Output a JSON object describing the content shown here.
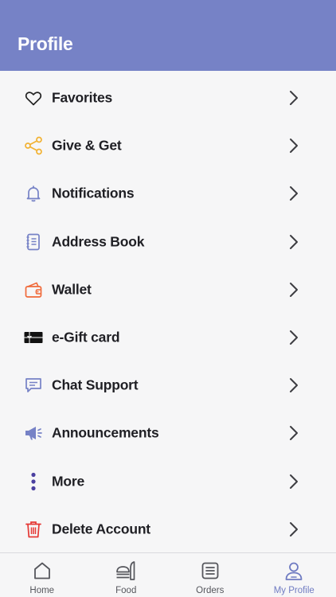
{
  "header": {
    "title": "Profile"
  },
  "colors": {
    "header_bg": "#7682c6",
    "accent": "#6f7bc2",
    "background": "#f6f6f7",
    "text": "#1f1f24"
  },
  "menu": {
    "items": [
      {
        "label": "Favorites",
        "icon": "heart-icon"
      },
      {
        "label": "Give & Get",
        "icon": "share-icon"
      },
      {
        "label": "Notifications",
        "icon": "bell-icon"
      },
      {
        "label": "Address Book",
        "icon": "address-book-icon"
      },
      {
        "label": "Wallet",
        "icon": "wallet-icon"
      },
      {
        "label": "e-Gift card",
        "icon": "gift-card-icon"
      },
      {
        "label": "Chat Support",
        "icon": "chat-icon"
      },
      {
        "label": "Announcements",
        "icon": "megaphone-icon"
      },
      {
        "label": "More",
        "icon": "more-vertical-icon"
      },
      {
        "label": "Delete Account",
        "icon": "trash-icon"
      }
    ]
  },
  "tabbar": {
    "active": "My Profile",
    "tabs": [
      {
        "label": "Home",
        "icon": "home-icon"
      },
      {
        "label": "Food",
        "icon": "food-icon"
      },
      {
        "label": "Orders",
        "icon": "orders-icon"
      },
      {
        "label": "My Profile",
        "icon": "user-icon"
      }
    ]
  }
}
